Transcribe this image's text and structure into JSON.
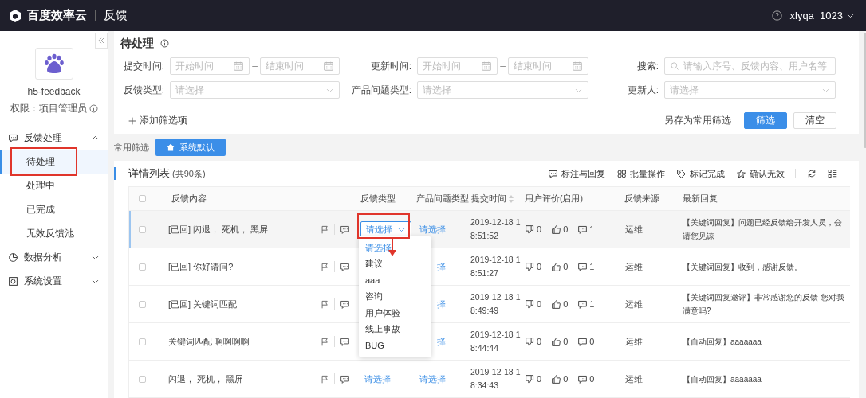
{
  "header": {
    "brand": "百度效率云",
    "section": "反馈",
    "user": "xlyqa_1023"
  },
  "sidebar": {
    "project": "h5-feedback",
    "role": "权限：项目管理员",
    "menus": [
      {
        "label": "反馈处理",
        "expanded": true,
        "children": [
          {
            "label": "待处理",
            "selected": true
          },
          {
            "label": "处理中",
            "selected": false
          },
          {
            "label": "已完成",
            "selected": false
          },
          {
            "label": "无效反馈池",
            "selected": false
          }
        ]
      },
      {
        "label": "数据分析",
        "expanded": false
      },
      {
        "label": "系统设置",
        "expanded": false
      }
    ]
  },
  "page_title": "待处理",
  "filters": [
    {
      "kind": "date_range",
      "label": "提交时间:",
      "start": "开始时间",
      "separator": "–",
      "end": "结束时间"
    },
    {
      "kind": "date_range",
      "label": "更新时间:",
      "start": "开始时间",
      "separator": "–",
      "end": "结束时间"
    },
    {
      "kind": "search",
      "label": "搜索:",
      "placeholder": "请输入序号、反馈内容、用户名等"
    },
    {
      "kind": "select",
      "label": "反馈类型:",
      "placeholder": "请选择"
    },
    {
      "kind": "select",
      "label": "产品问题类型:",
      "placeholder": "请选择"
    },
    {
      "kind": "select",
      "label": "更新人:",
      "placeholder": "请选择"
    }
  ],
  "add_filter": "添加筛选项",
  "save_filter": "另存为常用筛选",
  "buttons": [
    {
      "kind": "primary",
      "label": "筛选"
    },
    {
      "kind": "default",
      "label": "清空"
    }
  ],
  "common_filters": {
    "label": "常用筛选",
    "button": "系统默认"
  },
  "list": {
    "title": "详情列表",
    "count": "(共90条)",
    "toolbar": [
      {
        "label": "标注与回复"
      },
      {
        "label": "批量操作"
      },
      {
        "label": "标记完成"
      },
      {
        "label": "确认无效"
      }
    ]
  },
  "table": {
    "header_checked": false,
    "columns": [
      "反馈内容",
      "反馈类型",
      "产品问题类型",
      "提交时间",
      "用户评价(启用)",
      "反馈来源",
      "最新回复"
    ],
    "rows": [
      {
        "selected": true,
        "checked": false,
        "content": "[已回] 闪退， 死机， 黑屏",
        "feedback_type": {
          "kind": "select",
          "text": "请选择"
        },
        "product_type": "请选择",
        "time": [
          "2019-12-18 1",
          "8:51:52"
        ],
        "down": "0",
        "up": "0",
        "comments": "1",
        "source": "运维",
        "reply": [
          "【关键词回复】问题已经反馈给开发人员，会",
          "请您见谅"
        ]
      },
      {
        "selected": false,
        "checked": false,
        "content": "[已回] 你好请问?",
        "product_type": "择",
        "time": [
          "2019-12-18 1",
          "8:51:27"
        ],
        "down": "0",
        "up": "0",
        "comments": "1",
        "source": "运维",
        "reply": [
          "【关键词回复】收到，感谢反馈。"
        ]
      },
      {
        "selected": false,
        "checked": false,
        "content": "[已回] 关键词匹配",
        "product_type": "择",
        "time": [
          "2019-12-18 1",
          "8:49:49"
        ],
        "down": "0",
        "up": "0",
        "comments": "1",
        "source": "运维",
        "reply": [
          "【关键词回复邀评】非常感谢您的反馈-您对我",
          "满意吗?"
        ]
      },
      {
        "selected": false,
        "checked": false,
        "content": "关键词匹配 啊啊啊啊",
        "product_type": "择",
        "time": [
          "2019-12-18 1",
          "8:44:44"
        ],
        "down": "0",
        "up": "0",
        "comments": "0",
        "source": "运维",
        "reply": [
          "【自动回复】aaaaaaa"
        ]
      },
      {
        "selected": false,
        "checked": false,
        "content": "闪退， 死机， 黑屏",
        "feedback_type": {
          "kind": "link",
          "text": "请选择"
        },
        "product_type": "请选择",
        "time": [
          "2019-12-18 1",
          "8:34:43"
        ],
        "down": "0",
        "up": "0",
        "comments": "0",
        "source": "运维",
        "reply": [
          "【自动回复】aaaaaaa"
        ]
      }
    ]
  },
  "dropdown": {
    "options": [
      {
        "label": "请选择",
        "selected": true
      },
      {
        "label": "建议",
        "selected": false
      },
      {
        "label": "aaa",
        "selected": false
      },
      {
        "label": "咨询",
        "selected": false
      },
      {
        "label": "用户体验",
        "selected": false
      },
      {
        "label": "线上事故",
        "selected": false
      },
      {
        "label": "BUG",
        "selected": false
      }
    ]
  }
}
